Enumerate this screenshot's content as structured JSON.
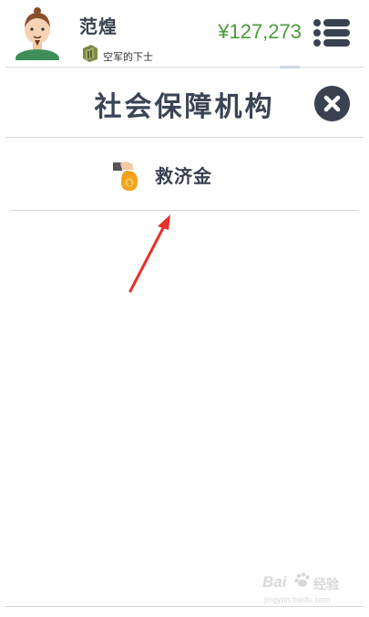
{
  "header": {
    "player_name": "范煌",
    "rank": "空军的下士",
    "money": "¥127,273"
  },
  "panel": {
    "title": "社会保障机构"
  },
  "items": [
    {
      "label": "救济金",
      "icon": "money-bag-icon"
    }
  ],
  "watermark": {
    "brand_latin": "Bai",
    "brand_cn": "经验",
    "url": "jingyan.baidu.com"
  },
  "colors": {
    "money": "#4a9a3c",
    "title_text": "#3a4454",
    "close_button": "#3a4150",
    "arrow": "#e8302a"
  }
}
